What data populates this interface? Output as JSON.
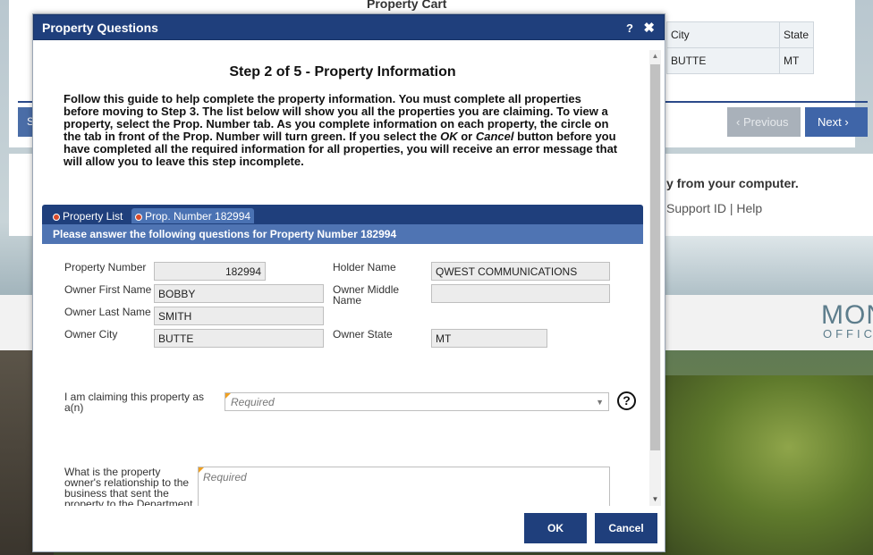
{
  "background": {
    "cart_title": "Property Cart",
    "table": {
      "headers": [
        "City",
        "State"
      ],
      "row": [
        "BUTTE",
        "MT"
      ]
    },
    "left_button_fragment": "S",
    "previous_label": "Previous",
    "next_label": "Next",
    "computer_text": "y from your computer.",
    "support_text": "Support ID | Help",
    "logo_text": "MON",
    "logo_sub": "OFFIC"
  },
  "modal": {
    "title": "Property Questions",
    "help_glyph": "?",
    "close_glyph": "✖",
    "step_title": "Step 2 of 5 - Property Information",
    "intro_parts": {
      "p1": "Follow this guide to help complete the property information. You must complete all properties before moving to Step 3. The list below will show you all the properties you are claiming. To view a property, select the Prop. Number tab. As you complete information on each property, the circle on the tab in front of the Prop. Number will turn green. If you select the ",
      "ok": "OK",
      "or": " or ",
      "cancel": "Cancel",
      "p2": " button before you have completed all the required information for all properties, you will receive an error message that will allow you to leave this step incomplete."
    },
    "tabs": {
      "property_list": "Property List",
      "prop_number": "Prop. Number 182994"
    },
    "question_header": "Please answer the following questions for Property Number 182994",
    "fields": {
      "property_number_label": "Property Number",
      "property_number_value": "182994",
      "holder_name_label": "Holder Name",
      "holder_name_value": "QWEST COMMUNICATIONS",
      "owner_first_label": "Owner First Name",
      "owner_first_value": "BOBBY",
      "owner_middle_label": "Owner Middle Name",
      "owner_middle_value": "",
      "owner_last_label": "Owner Last Name",
      "owner_last_value": "SMITH",
      "owner_city_label": "Owner City",
      "owner_city_value": "BUTTE",
      "owner_state_label": "Owner State",
      "owner_state_value": "MT"
    },
    "claim_label": "I am claiming this property as a(n)",
    "claim_placeholder": "Required",
    "claim_help": "?",
    "relationship_label": "What is the property owner's relationship to the business that sent the property to the Department",
    "relationship_placeholder": "Required",
    "ok_label": "OK",
    "cancel_label": "Cancel"
  }
}
